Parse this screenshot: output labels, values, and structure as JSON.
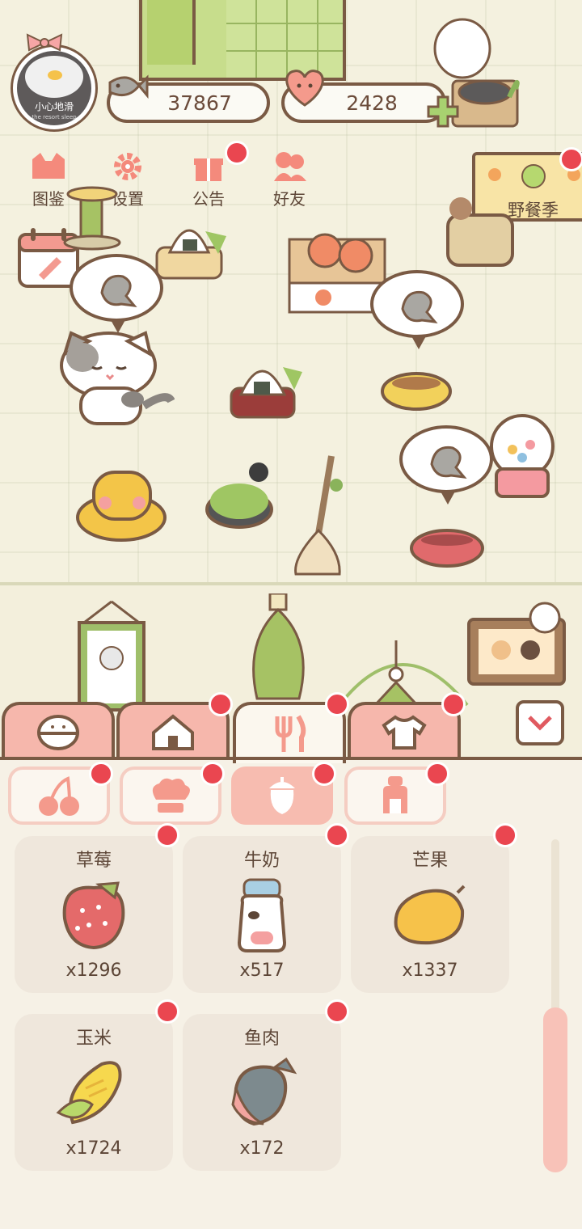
{
  "player": {
    "name": "小心地滑",
    "subtitle": "the resort sleep"
  },
  "currency": {
    "fish": "37867",
    "hearts": "2428"
  },
  "menu": [
    {
      "label": "图鉴",
      "icon": "cat-book-icon"
    },
    {
      "label": "设置",
      "icon": "gear-icon"
    },
    {
      "label": "公告",
      "icon": "gift-icon"
    },
    {
      "label": "好友",
      "icon": "friends-icon"
    }
  ],
  "event": {
    "label": "野餐季"
  },
  "main_tabs": [
    {
      "icon": "cat-bed-icon",
      "active": false
    },
    {
      "icon": "house-icon",
      "active": false
    },
    {
      "icon": "fork-knife-icon",
      "active": true
    },
    {
      "icon": "shirt-icon",
      "active": false
    }
  ],
  "sub_tabs": [
    {
      "icon": "cherry-icon",
      "active": false
    },
    {
      "icon": "chef-hat-icon",
      "active": false
    },
    {
      "icon": "acorn-icon",
      "active": true
    },
    {
      "icon": "jar-icon",
      "active": false
    }
  ],
  "items": [
    {
      "name": "草莓",
      "count": "x1296",
      "icon": "strawberry-icon"
    },
    {
      "name": "牛奶",
      "count": "x517",
      "icon": "milk-icon"
    },
    {
      "name": "芒果",
      "count": "x1337",
      "icon": "mango-icon"
    },
    {
      "name": "玉米",
      "count": "x1724",
      "icon": "corn-icon"
    },
    {
      "name": "鱼肉",
      "count": "x172",
      "icon": "fish-meat-icon"
    }
  ],
  "colors": {
    "accent": "#f7bcb0",
    "outline": "#7a5a44",
    "badge": "#ea4650",
    "panel": "#f6f1e6"
  },
  "scroll_position": 0.55
}
